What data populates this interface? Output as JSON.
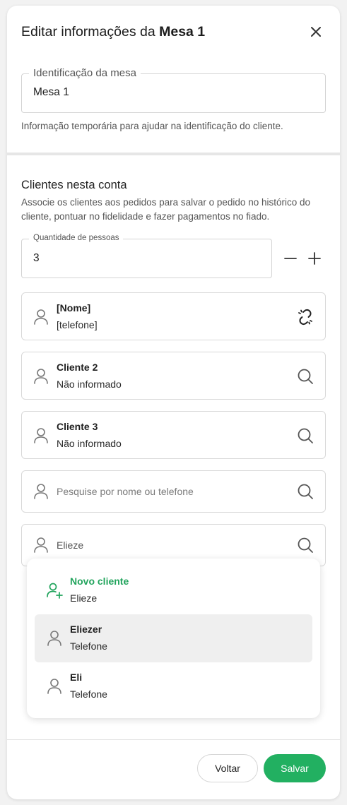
{
  "header": {
    "title_prefix": "Editar informações da ",
    "title_table": "Mesa 1"
  },
  "identification": {
    "label": "Identificação da mesa",
    "value": "Mesa 1",
    "helper": "Informação temporária para ajudar na identificação do cliente."
  },
  "clients_section": {
    "title": "Clientes nesta conta",
    "description": "Associe os clientes aos pedidos para salvar o pedido no histórico do cliente, pontuar no fidelidade e fazer pagamentos no fiado."
  },
  "people": {
    "label": "Quantidade de pessoas",
    "value": "3"
  },
  "clients": [
    {
      "name": "[Nome]",
      "sub": "[telefone]",
      "action_icon": "unlink-icon"
    },
    {
      "name": "Cliente 2",
      "sub": "Não informado",
      "action_icon": "search-icon"
    },
    {
      "name": "Cliente 3",
      "sub": "Não informado",
      "action_icon": "search-icon"
    }
  ],
  "search_empty": {
    "placeholder": "Pesquise por nome ou telefone"
  },
  "search_active": {
    "value": "Elieze"
  },
  "dropdown": [
    {
      "name": "Novo cliente",
      "sub": "Elieze",
      "icon": "add-user-icon",
      "accent": "#22a45d"
    },
    {
      "name": "Eliezer",
      "sub": "Telefone",
      "icon": "user-icon",
      "highlighted": true
    },
    {
      "name": "Eli",
      "sub": "Telefone",
      "icon": "user-icon"
    }
  ],
  "footer": {
    "back_label": "Voltar",
    "save_label": "Salvar"
  },
  "colors": {
    "accent": "#22b061",
    "accent_text": "#22a45d",
    "border": "#d9d9d9"
  }
}
